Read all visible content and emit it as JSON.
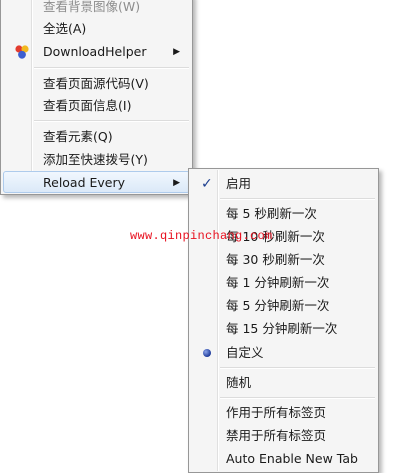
{
  "main_menu": {
    "items": [
      {
        "label": "查看背景图像(W)",
        "disabled": true
      },
      {
        "label": "全选(A)"
      },
      {
        "label": "DownloadHelper"
      },
      {
        "label": "查看页面源代码(V)"
      },
      {
        "label": "查看页面信息(I)"
      },
      {
        "label": "查看元素(Q)"
      },
      {
        "label": "添加至快速拨号(Y)"
      },
      {
        "label": "Reload Every"
      }
    ]
  },
  "submenu": {
    "items": [
      {
        "label": "启用",
        "checked": true
      },
      {
        "label": "每 5 秒刷新一次"
      },
      {
        "label": "每 10 秒刷新一次"
      },
      {
        "label": "每 30 秒刷新一次"
      },
      {
        "label": "每 1 分钟刷新一次"
      },
      {
        "label": "每 5 分钟刷新一次"
      },
      {
        "label": "每 15 分钟刷新一次"
      },
      {
        "label": "自定义",
        "selected": true
      },
      {
        "label": "随机"
      },
      {
        "label": "作用于所有标签页"
      },
      {
        "label": "禁用于所有标签页"
      },
      {
        "label": "Auto Enable New Tab"
      }
    ]
  },
  "watermark": "www.qinpinchang.com",
  "colors": {
    "highlight_bg": "#dbe9f8",
    "highlight_border": "#aecbec",
    "watermark": "#e8101f",
    "check": "#1d3f8f"
  }
}
